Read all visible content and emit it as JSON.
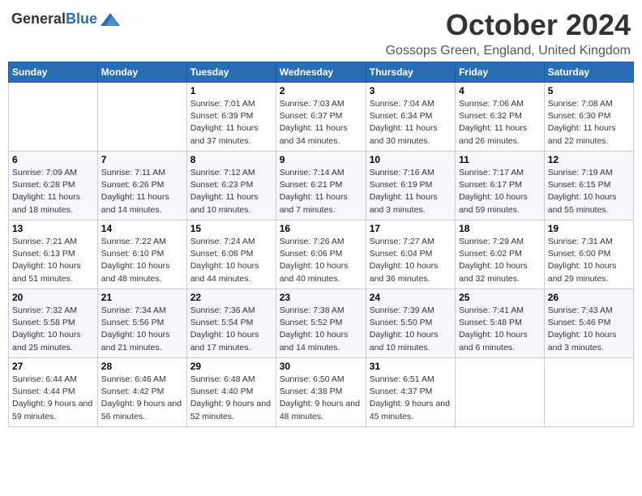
{
  "logo": {
    "general": "General",
    "blue": "Blue"
  },
  "title": {
    "month_year": "October 2024",
    "location": "Gossops Green, England, United Kingdom"
  },
  "headers": [
    "Sunday",
    "Monday",
    "Tuesday",
    "Wednesday",
    "Thursday",
    "Friday",
    "Saturday"
  ],
  "weeks": [
    [
      {
        "day": "",
        "info": ""
      },
      {
        "day": "",
        "info": ""
      },
      {
        "day": "1",
        "info": "Sunrise: 7:01 AM\nSunset: 6:39 PM\nDaylight: 11 hours and 37 minutes."
      },
      {
        "day": "2",
        "info": "Sunrise: 7:03 AM\nSunset: 6:37 PM\nDaylight: 11 hours and 34 minutes."
      },
      {
        "day": "3",
        "info": "Sunrise: 7:04 AM\nSunset: 6:34 PM\nDaylight: 11 hours and 30 minutes."
      },
      {
        "day": "4",
        "info": "Sunrise: 7:06 AM\nSunset: 6:32 PM\nDaylight: 11 hours and 26 minutes."
      },
      {
        "day": "5",
        "info": "Sunrise: 7:08 AM\nSunset: 6:30 PM\nDaylight: 11 hours and 22 minutes."
      }
    ],
    [
      {
        "day": "6",
        "info": "Sunrise: 7:09 AM\nSunset: 6:28 PM\nDaylight: 11 hours and 18 minutes."
      },
      {
        "day": "7",
        "info": "Sunrise: 7:11 AM\nSunset: 6:26 PM\nDaylight: 11 hours and 14 minutes."
      },
      {
        "day": "8",
        "info": "Sunrise: 7:12 AM\nSunset: 6:23 PM\nDaylight: 11 hours and 10 minutes."
      },
      {
        "day": "9",
        "info": "Sunrise: 7:14 AM\nSunset: 6:21 PM\nDaylight: 11 hours and 7 minutes."
      },
      {
        "day": "10",
        "info": "Sunrise: 7:16 AM\nSunset: 6:19 PM\nDaylight: 11 hours and 3 minutes."
      },
      {
        "day": "11",
        "info": "Sunrise: 7:17 AM\nSunset: 6:17 PM\nDaylight: 10 hours and 59 minutes."
      },
      {
        "day": "12",
        "info": "Sunrise: 7:19 AM\nSunset: 6:15 PM\nDaylight: 10 hours and 55 minutes."
      }
    ],
    [
      {
        "day": "13",
        "info": "Sunrise: 7:21 AM\nSunset: 6:13 PM\nDaylight: 10 hours and 51 minutes."
      },
      {
        "day": "14",
        "info": "Sunrise: 7:22 AM\nSunset: 6:10 PM\nDaylight: 10 hours and 48 minutes."
      },
      {
        "day": "15",
        "info": "Sunrise: 7:24 AM\nSunset: 6:08 PM\nDaylight: 10 hours and 44 minutes."
      },
      {
        "day": "16",
        "info": "Sunrise: 7:26 AM\nSunset: 6:06 PM\nDaylight: 10 hours and 40 minutes."
      },
      {
        "day": "17",
        "info": "Sunrise: 7:27 AM\nSunset: 6:04 PM\nDaylight: 10 hours and 36 minutes."
      },
      {
        "day": "18",
        "info": "Sunrise: 7:29 AM\nSunset: 6:02 PM\nDaylight: 10 hours and 32 minutes."
      },
      {
        "day": "19",
        "info": "Sunrise: 7:31 AM\nSunset: 6:00 PM\nDaylight: 10 hours and 29 minutes."
      }
    ],
    [
      {
        "day": "20",
        "info": "Sunrise: 7:32 AM\nSunset: 5:58 PM\nDaylight: 10 hours and 25 minutes."
      },
      {
        "day": "21",
        "info": "Sunrise: 7:34 AM\nSunset: 5:56 PM\nDaylight: 10 hours and 21 minutes."
      },
      {
        "day": "22",
        "info": "Sunrise: 7:36 AM\nSunset: 5:54 PM\nDaylight: 10 hours and 17 minutes."
      },
      {
        "day": "23",
        "info": "Sunrise: 7:38 AM\nSunset: 5:52 PM\nDaylight: 10 hours and 14 minutes."
      },
      {
        "day": "24",
        "info": "Sunrise: 7:39 AM\nSunset: 5:50 PM\nDaylight: 10 hours and 10 minutes."
      },
      {
        "day": "25",
        "info": "Sunrise: 7:41 AM\nSunset: 5:48 PM\nDaylight: 10 hours and 6 minutes."
      },
      {
        "day": "26",
        "info": "Sunrise: 7:43 AM\nSunset: 5:46 PM\nDaylight: 10 hours and 3 minutes."
      }
    ],
    [
      {
        "day": "27",
        "info": "Sunrise: 6:44 AM\nSunset: 4:44 PM\nDaylight: 9 hours and 59 minutes."
      },
      {
        "day": "28",
        "info": "Sunrise: 6:46 AM\nSunset: 4:42 PM\nDaylight: 9 hours and 56 minutes."
      },
      {
        "day": "29",
        "info": "Sunrise: 6:48 AM\nSunset: 4:40 PM\nDaylight: 9 hours and 52 minutes."
      },
      {
        "day": "30",
        "info": "Sunrise: 6:50 AM\nSunset: 4:38 PM\nDaylight: 9 hours and 48 minutes."
      },
      {
        "day": "31",
        "info": "Sunrise: 6:51 AM\nSunset: 4:37 PM\nDaylight: 9 hours and 45 minutes."
      },
      {
        "day": "",
        "info": ""
      },
      {
        "day": "",
        "info": ""
      }
    ]
  ]
}
